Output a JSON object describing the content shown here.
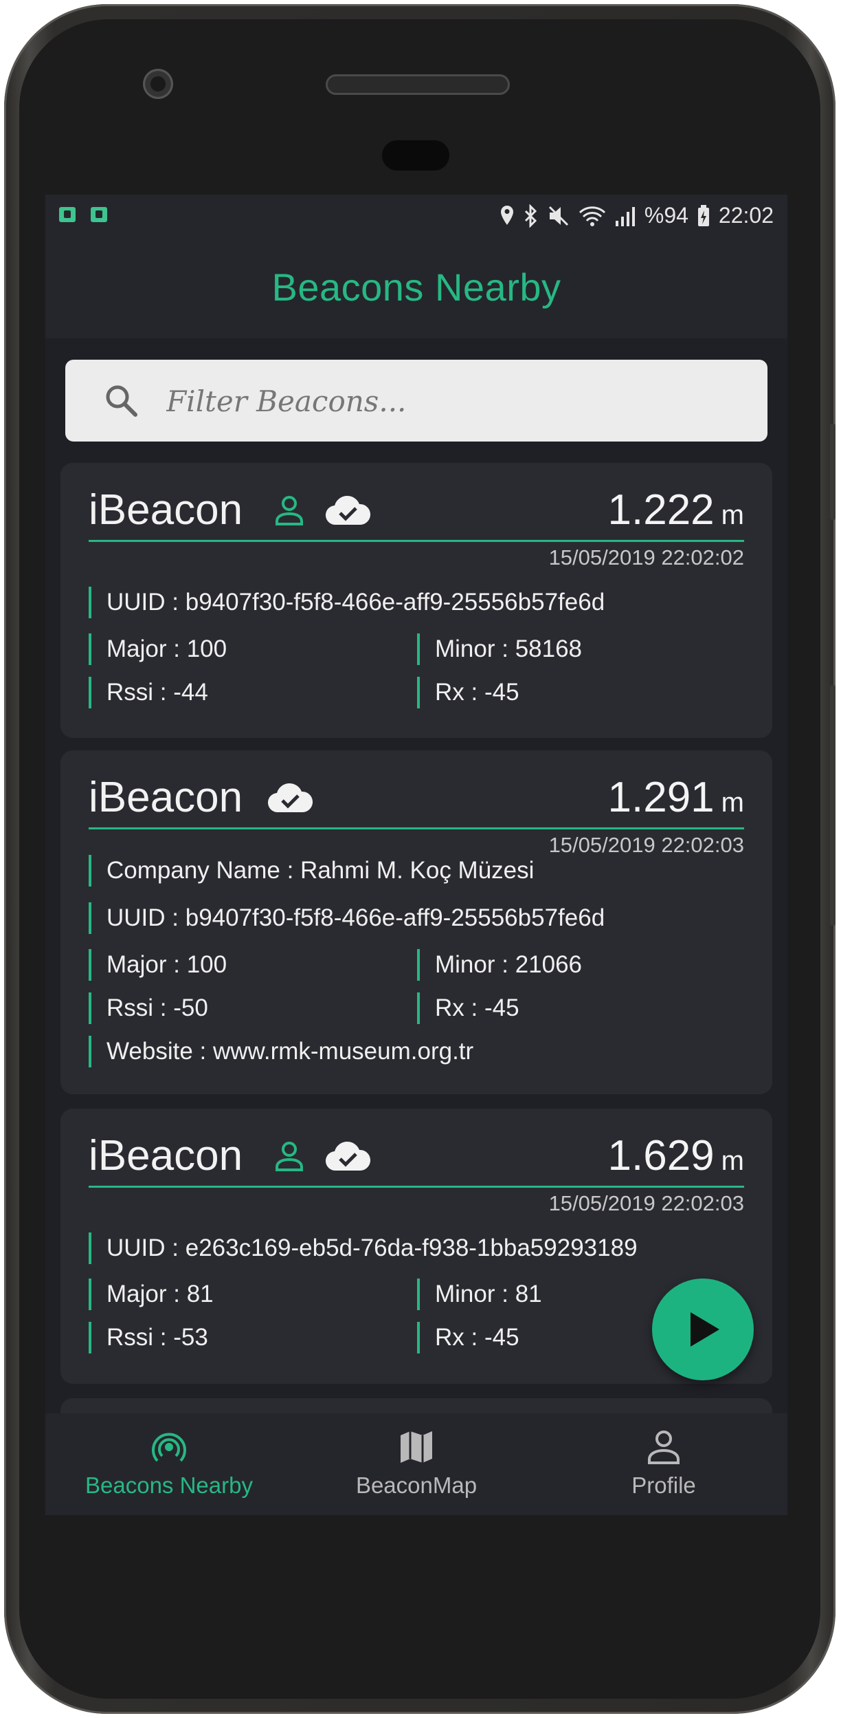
{
  "status_bar": {
    "battery_percent": "%94",
    "time": "22:02",
    "icons": [
      "location-icon",
      "bluetooth-icon",
      "mute-icon",
      "wifi-icon",
      "signal-icon",
      "battery-icon"
    ]
  },
  "app_bar": {
    "title": "Beacons Nearby"
  },
  "search": {
    "placeholder": "Filter Beacons..."
  },
  "beacons": [
    {
      "type": "iBeacon",
      "distance": "1.222",
      "unit": "m",
      "timestamp": "15/05/2019 22:02:02",
      "uuid": "UUID : b9407f30-f5f8-466e-aff9-25556b57fe6d",
      "major": "Major : 100",
      "minor": "Minor : 58168",
      "rssi": "Rssi : -44",
      "rx": "Rx : -45"
    },
    {
      "type": "iBeacon",
      "distance": "1.291",
      "unit": "m",
      "timestamp": "15/05/2019 22:02:03",
      "company": "Company Name : Rahmi M. Koç Müzesi",
      "uuid": "UUID : b9407f30-f5f8-466e-aff9-25556b57fe6d",
      "major": "Major : 100",
      "minor": "Minor : 21066",
      "rssi": "Rssi : -50",
      "rx": "Rx : -45",
      "website": "Website : www.rmk-museum.org.tr"
    },
    {
      "type": "iBeacon",
      "distance": "1.629",
      "unit": "m",
      "timestamp": "15/05/2019 22:02:03",
      "uuid": "UUID : e263c169-eb5d-76da-f938-1bba59293189",
      "major": "Major : 81",
      "minor": "Minor : 81",
      "rssi": "Rssi : -53",
      "rx": "Rx : -45"
    }
  ],
  "bottom_nav": {
    "items": [
      {
        "label": "Beacons Nearby",
        "icon": "beacon-icon",
        "active": true
      },
      {
        "label": "BeaconMap",
        "icon": "map-icon",
        "active": false
      },
      {
        "label": "Profile",
        "icon": "person-icon",
        "active": false
      }
    ]
  },
  "colors": {
    "accent": "#27b883",
    "background": "#1f2026",
    "card": "#2a2b31",
    "bar": "#25262c",
    "fab": "#1db380",
    "nav_inactive": "#b9b9b9"
  }
}
